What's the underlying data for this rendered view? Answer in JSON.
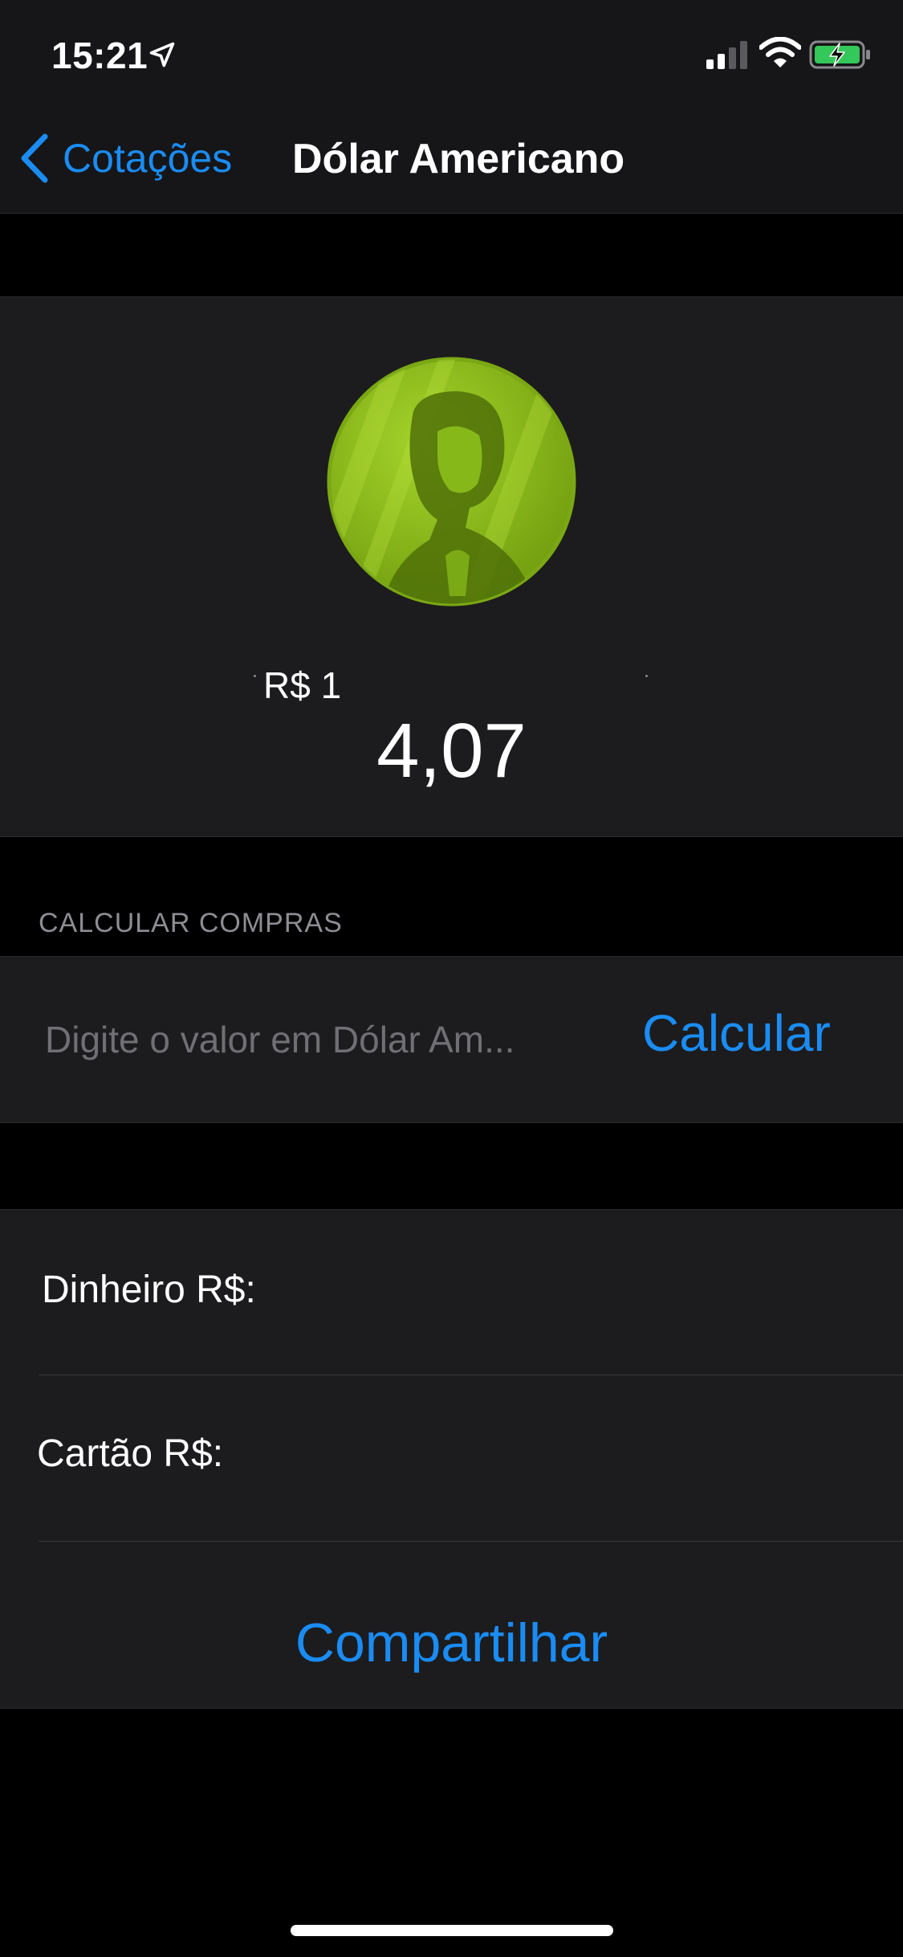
{
  "status_bar": {
    "time": "15:21"
  },
  "nav": {
    "back_label": "Cotações",
    "title": "Dólar Americano"
  },
  "quote": {
    "label": "R$ 1",
    "value": "4,07"
  },
  "calculator": {
    "section_header": "CALCULAR COMPRAS",
    "placeholder": "Digite o valor em Dólar Am...",
    "value": "",
    "button_label": "Calcular"
  },
  "results": {
    "cash_label": "Dinheiro R$:",
    "card_label": "Cartão R$:",
    "share_label": "Compartilhar"
  },
  "colors": {
    "accent": "#1a8cf4",
    "background": "#000000",
    "card": "#1c1c1e",
    "coin": "#8ec21a"
  }
}
